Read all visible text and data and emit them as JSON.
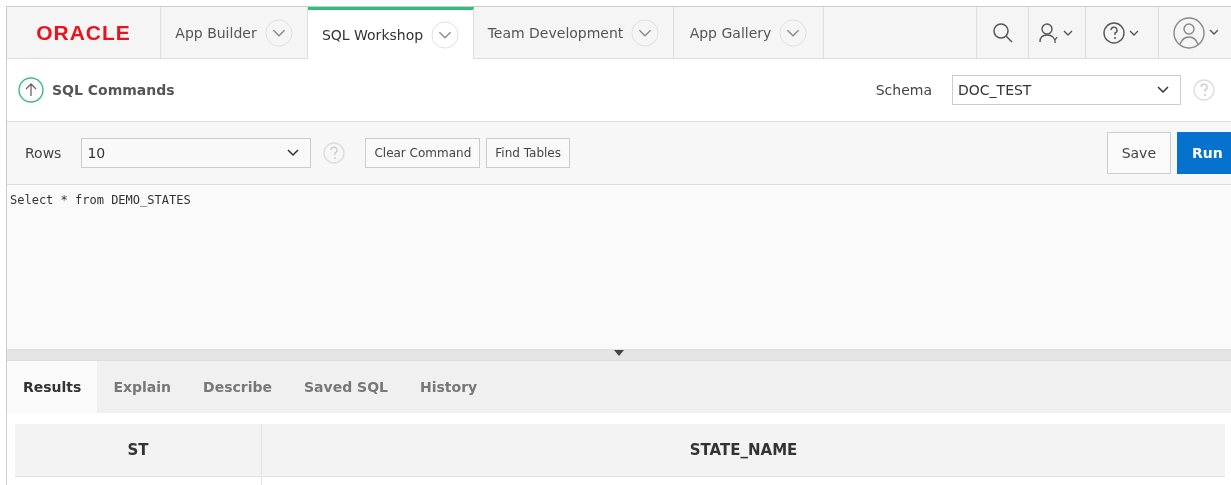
{
  "header": {
    "logo": "ORACLE",
    "tabs": [
      {
        "label": "App Builder",
        "selected": false
      },
      {
        "label": "SQL Workshop",
        "selected": true
      },
      {
        "label": "Team Development",
        "selected": false
      },
      {
        "label": "App Gallery",
        "selected": false
      }
    ]
  },
  "page": {
    "title": "SQL Commands",
    "schema": {
      "label": "Schema",
      "value": "DOC_TEST"
    }
  },
  "toolbar": {
    "rows": {
      "label": "Rows",
      "value": "10"
    },
    "buttons": [
      "Clear Command",
      "Find Tables"
    ],
    "save": "Save",
    "run": "Run"
  },
  "editor": {
    "value": "Select * from DEMO_STATES"
  },
  "result_tabs": [
    {
      "label": "Results",
      "selected": true
    },
    {
      "label": "Explain",
      "selected": false
    },
    {
      "label": "Describe",
      "selected": false
    },
    {
      "label": "Saved SQL",
      "selected": false
    },
    {
      "label": "History",
      "selected": false
    }
  ],
  "table": {
    "columns": [
      "ST",
      "STATE_NAME"
    ]
  }
}
